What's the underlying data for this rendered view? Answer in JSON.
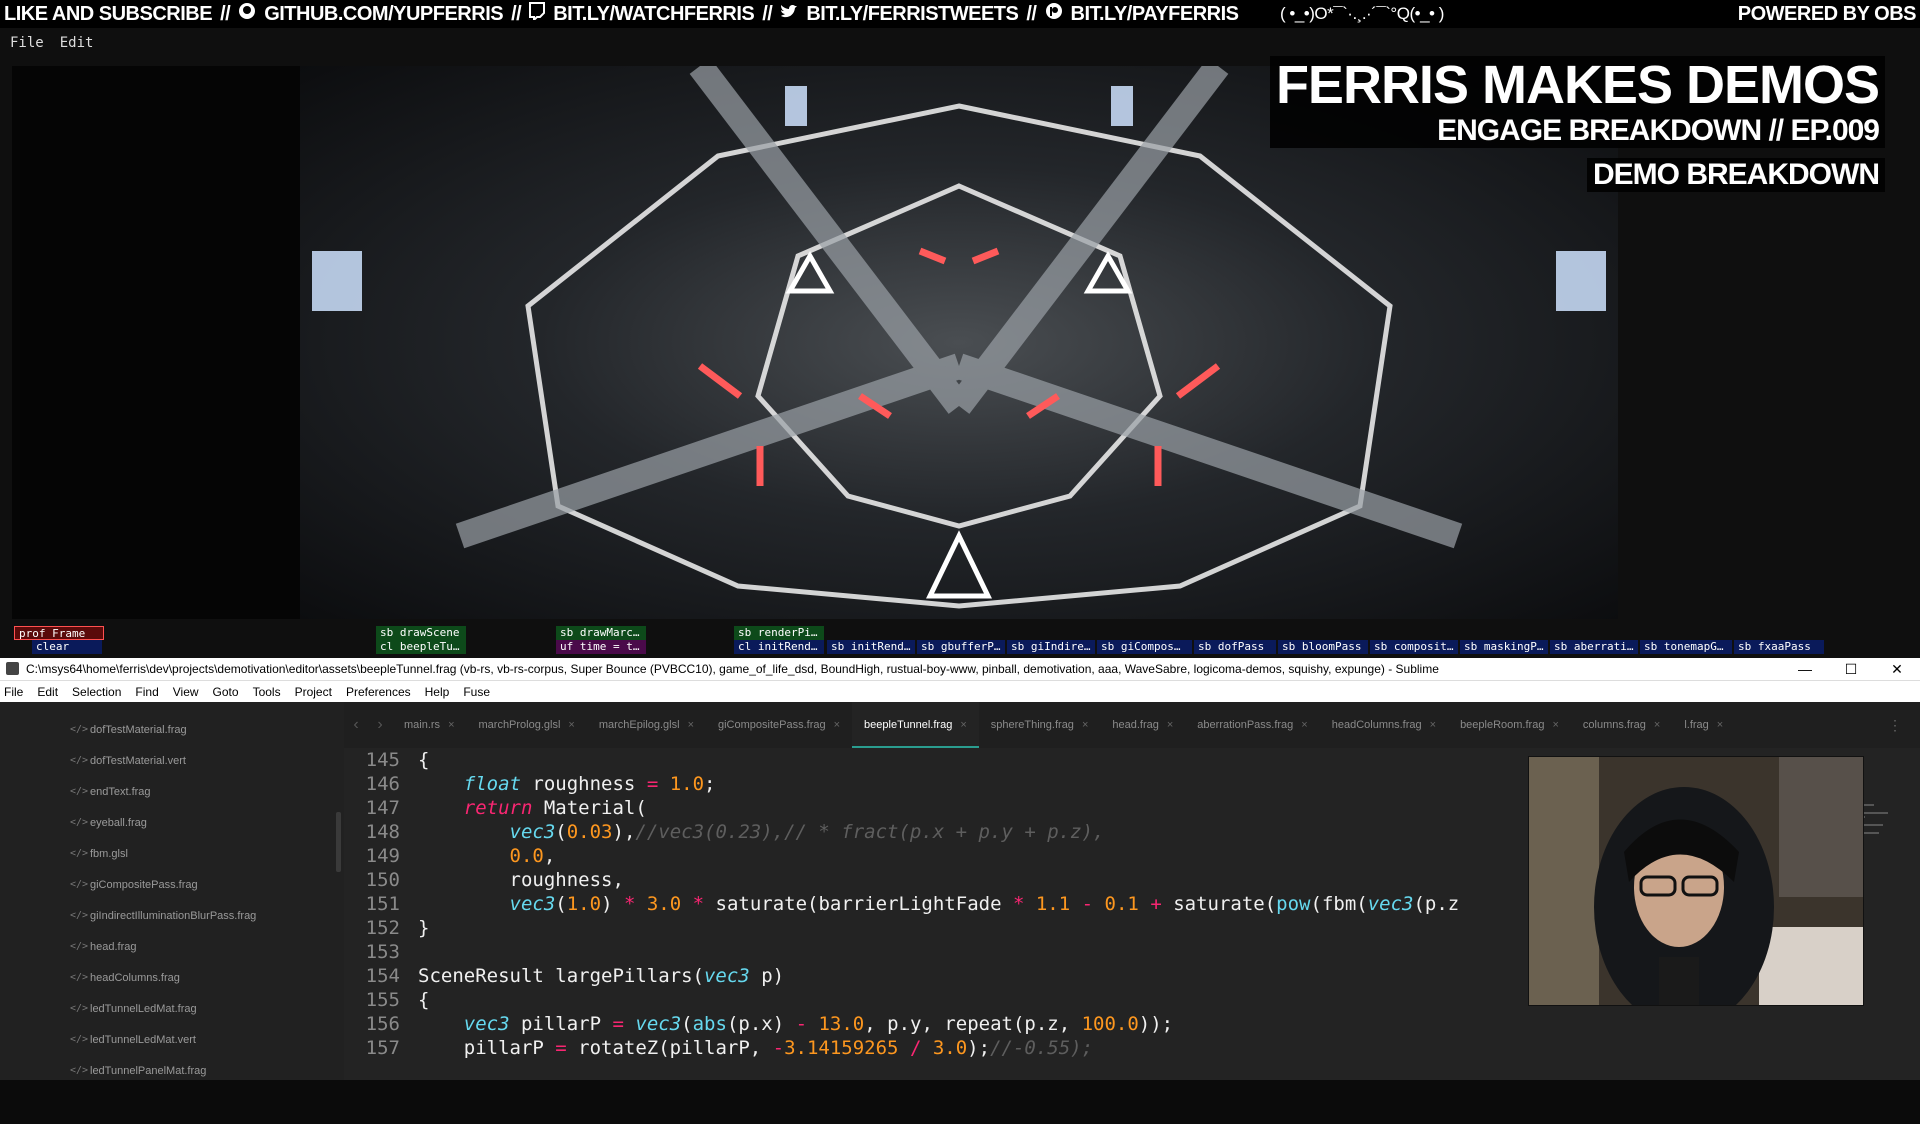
{
  "banner": {
    "like": "LIKE AND SUBSCRIBE",
    "github": "GITHUB.COM/YUPFERRIS",
    "watch": "BIT.LY/WATCHFERRIS",
    "tweets": "BIT.LY/FERRISTWEETS",
    "pay": "BIT.LY/PAYFERRIS",
    "sep": "//",
    "face": "( •_•)O*¯`·.¸.·´¯`°Q(•_• )",
    "obs": "POWERED BY OBS"
  },
  "app_menu": {
    "file": "File",
    "edit": "Edit"
  },
  "overlay": {
    "line1": "FERRIS MAKES DEMOS",
    "line2": "ENGAGE BREAKDOWN // EP.009",
    "line3": "DEMO BREAKDOWN"
  },
  "profiler": {
    "row1": [
      "prof Frame",
      "sb drawScene",
      "sb drawMarc…",
      "sb renderPi…"
    ],
    "row2": [
      "clear",
      "cl beepleTu…",
      "uf time = t…",
      "cl initRend…",
      "sb initRend…",
      "sb gbufferP…",
      "sb giIndire…",
      "sb giCompos…",
      "sb dofPass",
      "sb bloomPass",
      "sb composit…",
      "sb maskingP…",
      "sb aberrati…",
      "sb tonemapG…",
      "sb fxaaPass"
    ]
  },
  "sublime": {
    "title": "C:\\msys64\\home\\ferris\\dev\\projects\\demotivation\\editor\\assets\\beepleTunnel.frag (vb-rs, vb-rs-corpus, Super Bounce (PVBCC10), game_of_life_dsd, BoundHigh, rustual-boy-www, pinball, demotivation, aaa, WaveSabre, logicoma-demos, squishy, expunge) - Sublime",
    "window_controls": {
      "minimize": "—",
      "maximize": "☐",
      "close": "✕"
    },
    "menu": [
      "File",
      "Edit",
      "Selection",
      "Find",
      "View",
      "Goto",
      "Tools",
      "Project",
      "Preferences",
      "Help",
      "Fuse"
    ],
    "sidebar_files": [
      "dofTestMaterial.frag",
      "dofTestMaterial.vert",
      "endText.frag",
      "eyeball.frag",
      "fbm.glsl",
      "giCompositePass.frag",
      "giIndirectIlluminationBlurPass.frag",
      "head.frag",
      "headColumns.frag",
      "ledTunnelLedMat.frag",
      "ledTunnelLedMat.vert",
      "ledTunnelPanelMat.frag"
    ],
    "file_icon": "</>",
    "tabs": [
      "main.rs",
      "marchProlog.glsl",
      "marchEpilog.glsl",
      "giCompositePass.frag",
      "beepleTunnel.frag",
      "sphereThing.frag",
      "head.frag",
      "aberrationPass.frag",
      "headColumns.frag",
      "beepleRoom.frag",
      "columns.frag",
      "l.frag"
    ],
    "active_tab": "beepleTunnel.frag",
    "line_numbers": [
      "145",
      "146",
      "147",
      "148",
      "149",
      "150",
      "151",
      "152",
      "153",
      "154",
      "155",
      "156",
      "157"
    ]
  },
  "colors": {
    "accent_tab": "#2a9d8f",
    "keyword": "#f92672",
    "type": "#66d9ef",
    "number": "#fd971f",
    "editor_bg": "#232323"
  }
}
